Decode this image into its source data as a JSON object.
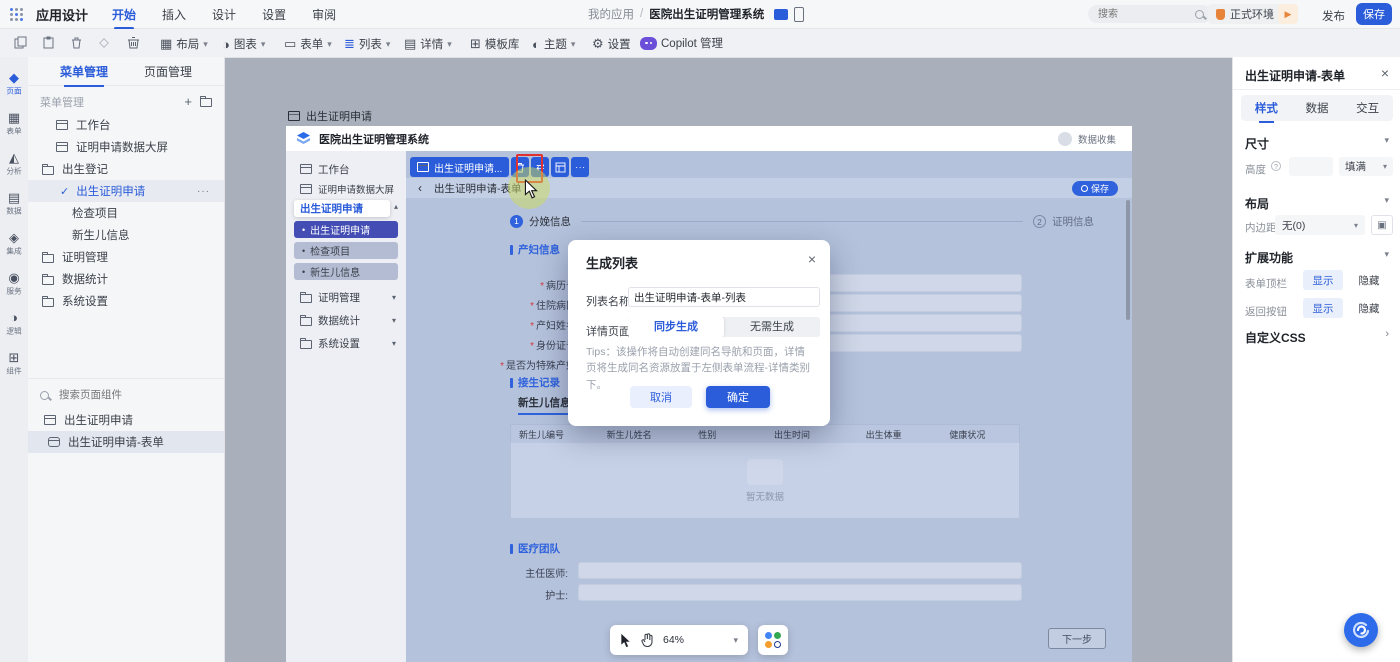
{
  "icons": {
    "chevron_down": "▾",
    "chevron_up": "▴",
    "chevron_right": "›",
    "back": "‹",
    "close": "×",
    "check": "✓",
    "more": "···",
    "plus": "+",
    "bullet": "•",
    "swap": "⇄",
    "info": "?",
    "border_btn": "▣",
    "play": "▶",
    "slash": "/"
  },
  "topbar": {
    "app_title": "应用设计",
    "tabs": [
      {
        "label": "开始"
      },
      {
        "label": "插入"
      },
      {
        "label": "设计"
      },
      {
        "label": "设置"
      },
      {
        "label": "审阅"
      }
    ],
    "breadcrumb": {
      "parent": "我的应用",
      "current": "医院出生证明管理系统"
    },
    "search_placeholder": "搜索",
    "env_label": "正式环境",
    "publish_label": "发布",
    "save_label": "保存"
  },
  "ribbon": {
    "groups": [
      {
        "label": "布局",
        "glyph": "▦",
        "dropdown": true
      },
      {
        "label": "图表",
        "glyph": "◑",
        "dropdown": true
      },
      {
        "label": "表单",
        "glyph": "▭",
        "dropdown": true
      },
      {
        "label": "列表",
        "glyph": "≣",
        "dropdown": true
      },
      {
        "label": "详情",
        "glyph": "▤",
        "dropdown": true
      },
      {
        "label": "模板库",
        "glyph": "⊞",
        "dropdown": false
      },
      {
        "label": "主题",
        "glyph": "◐",
        "dropdown": true
      },
      {
        "label": "设置",
        "glyph": "⚙",
        "dropdown": false
      },
      {
        "label": "Copilot 管理",
        "glyph": "",
        "dropdown": false
      }
    ]
  },
  "rail": {
    "items": [
      {
        "label": "页面",
        "glyph": "◆"
      },
      {
        "label": "表单",
        "glyph": "▦"
      },
      {
        "label": "分析",
        "glyph": "◭"
      },
      {
        "label": "数据",
        "glyph": "▤"
      },
      {
        "label": "集成",
        "glyph": "◈"
      },
      {
        "label": "服务",
        "glyph": "◉"
      },
      {
        "label": "逻辑",
        "glyph": "◑"
      },
      {
        "label": "组件",
        "glyph": "⊞"
      }
    ]
  },
  "sidebar": {
    "tabs": [
      {
        "label": "菜单管理"
      },
      {
        "label": "页面管理"
      }
    ],
    "section_label": "菜单管理",
    "tree": [
      {
        "label": "工作台"
      },
      {
        "label": "证明申请数据大屏"
      },
      {
        "label": "出生登记"
      },
      {
        "label": "出生证明申请"
      },
      {
        "label": "检查项目"
      },
      {
        "label": "新生儿信息"
      },
      {
        "label": "证明管理"
      },
      {
        "label": "数据统计"
      },
      {
        "label": "系统设置"
      }
    ],
    "components": {
      "search_placeholder": "搜索页面组件",
      "items": [
        {
          "label": "出生证明申请"
        },
        {
          "label": "出生证明申请-表单"
        }
      ]
    }
  },
  "canvas": {
    "page_tab": "出生证明申请",
    "app_header": {
      "title": "医院出生证明管理系统",
      "user": "数据收集"
    },
    "inner_menu": {
      "items": [
        {
          "label": "工作台"
        },
        {
          "label": "证明申请数据大屏"
        }
      ],
      "group_popover": "出生证明申请",
      "sub_items": [
        {
          "label": "出生证明申请"
        },
        {
          "label": "检查项目"
        },
        {
          "label": "新生儿信息"
        }
      ],
      "groups": [
        {
          "label": "证明管理"
        },
        {
          "label": "数据统计"
        },
        {
          "label": "系统设置"
        }
      ]
    },
    "selection_toolbar": {
      "chip_label": "出生证明申请..."
    },
    "page_bar": {
      "title": "出生证明申请-表单",
      "save_label": "保存"
    },
    "form": {
      "required_mark": "*",
      "steps": [
        {
          "num": "1",
          "label": "分娩信息"
        },
        {
          "num": "2",
          "label": "证明信息"
        }
      ],
      "section_mother": "产妇信息",
      "section_delivery": "接生记录",
      "section_team": "医疗团队",
      "fields": [
        {
          "label": "病历号"
        },
        {
          "label": "住院病区"
        },
        {
          "label": "产妇姓名"
        },
        {
          "label": "身份证号"
        },
        {
          "label": "是否为特殊产妇"
        }
      ],
      "record_tab": "新生儿信息",
      "table_headers": [
        "新生儿编号",
        "新生儿姓名",
        "性别",
        "出生时间",
        "出生体重",
        "健康状况"
      ],
      "empty_text": "暂无数据",
      "team_fields": [
        {
          "label": "主任医师:"
        },
        {
          "label": "护士:"
        }
      ],
      "next_label": "下一步"
    },
    "zoom_toolbar": {
      "zoom_value": "64%"
    }
  },
  "modal": {
    "title": "生成列表",
    "name_label": "列表名称",
    "name_value": "出生证明申请-表单-列表",
    "detail_label": "详情页面",
    "options": [
      {
        "label": "同步生成"
      },
      {
        "label": "无需生成"
      }
    ],
    "tips": "Tips：该操作将自动创建同名导航和页面，详情页将生成同名资源放置于左侧表单流程-详情类别下。",
    "cancel_label": "取消",
    "confirm_label": "确定"
  },
  "inspector": {
    "title": "出生证明申请-表单",
    "tabs": [
      {
        "label": "样式"
      },
      {
        "label": "数据"
      },
      {
        "label": "交互"
      }
    ],
    "size_section": {
      "title": "尺寸",
      "height_label": "高度",
      "fit_value": "填满"
    },
    "layout_section": {
      "title": "布局",
      "padding_label": "内边距",
      "padding_value": "无(0)"
    },
    "ext_section": {
      "title": "扩展功能",
      "rows": [
        {
          "label": "表单顶栏",
          "on": "显示",
          "off": "隐藏"
        },
        {
          "label": "返回按钮",
          "on": "显示",
          "off": "隐藏"
        }
      ]
    },
    "css_label": "自定义CSS"
  },
  "colors": {
    "accent": "#2b5cd9",
    "canvas_bg": "#a9b0bb",
    "selection_tint": "#b5c2dc",
    "highlight_red": "#e03131",
    "env_orange": "#e8833a"
  }
}
